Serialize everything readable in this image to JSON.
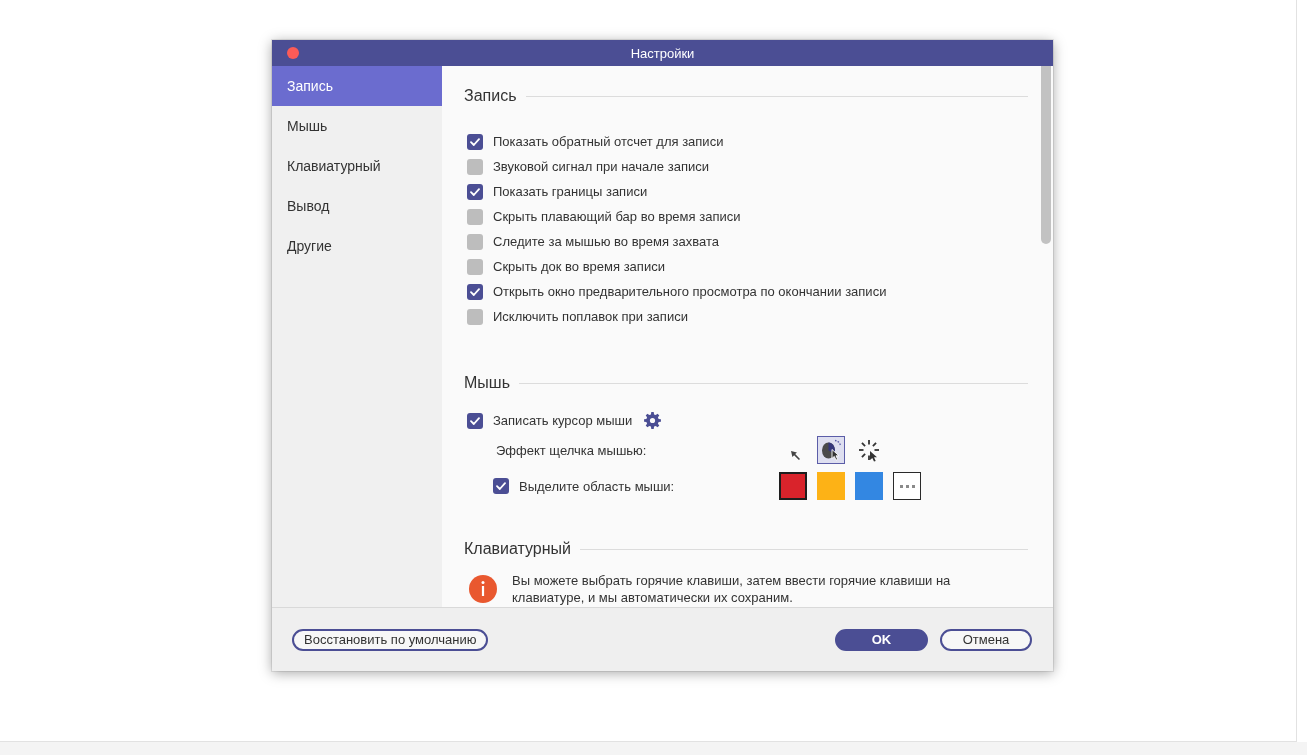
{
  "window": {
    "title": "Настройки"
  },
  "sidebar": {
    "items": [
      {
        "label": "Запись",
        "selected": true
      },
      {
        "label": "Мышь",
        "selected": false
      },
      {
        "label": "Клавиатурный",
        "selected": false
      },
      {
        "label": "Вывод",
        "selected": false
      },
      {
        "label": "Другие",
        "selected": false
      }
    ]
  },
  "sections": [
    {
      "kind": "checklist",
      "title": "Запись",
      "options": [
        {
          "label": "Показать обратный отсчет для записи",
          "checked": true
        },
        {
          "label": "Звуковой сигнал при начале записи",
          "checked": false
        },
        {
          "label": "Показать границы записи",
          "checked": true
        },
        {
          "label": "Скрыть плавающий бар во время записи",
          "checked": false
        },
        {
          "label": "Следите за мышью во время захвата",
          "checked": false
        },
        {
          "label": "Скрыть док во время записи",
          "checked": false
        },
        {
          "label": "Открыть окно предварительного просмотра по окончании записи",
          "checked": true
        },
        {
          "label": "Исключить поплавок при записи",
          "checked": false
        }
      ]
    },
    {
      "kind": "mouse",
      "title": "Мышь",
      "record_cursor": {
        "label": "Записать курсор мыши",
        "checked": true
      },
      "click_effect": {
        "label": "Эффект щелчка мышью:",
        "options": [
          {
            "kind": "arrow",
            "selected": false
          },
          {
            "kind": "ripple",
            "selected": true
          },
          {
            "kind": "burst",
            "selected": false
          }
        ]
      },
      "highlight": {
        "label": "Выделите область мыши:",
        "checked": true,
        "colors": [
          {
            "color": "#d9232b",
            "selected": true
          },
          {
            "color": "#fdb216",
            "selected": false
          },
          {
            "color": "#3387e2",
            "selected": false
          }
        ]
      }
    },
    {
      "kind": "info",
      "title": "Клавиатурный",
      "text": "Вы можете выбрать горячие клавиши, затем ввести горячие клавиши на клавиатуре, и мы автоматически их сохраним."
    }
  ],
  "footer": {
    "left_buttons": [
      {
        "label": "Восстановить по умолчанию",
        "kind": "secondary"
      }
    ],
    "right_buttons": [
      {
        "label": "OK",
        "kind": "primary"
      },
      {
        "label": "Отмена",
        "kind": "secondary"
      }
    ]
  }
}
